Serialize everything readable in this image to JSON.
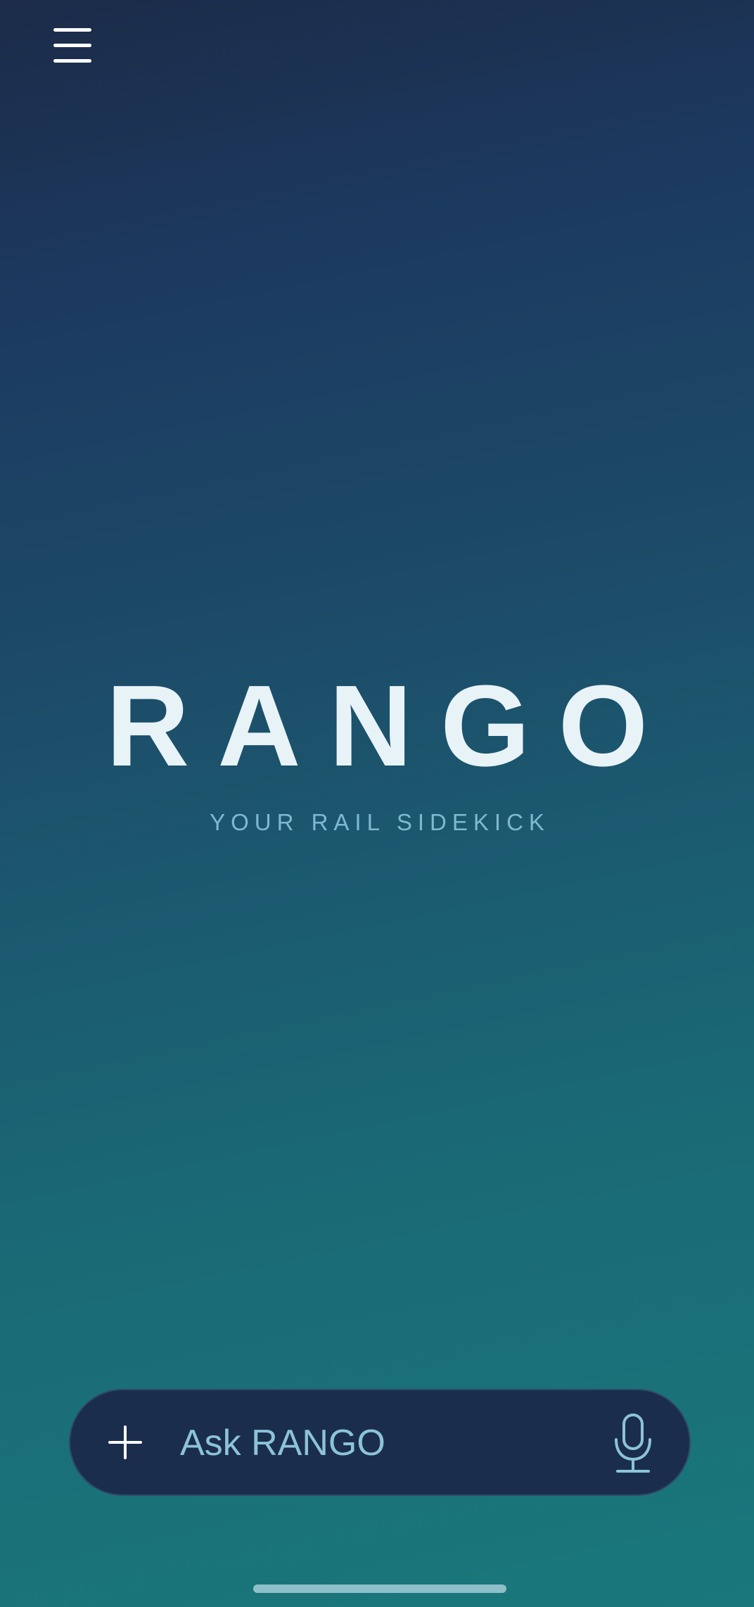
{
  "app": {
    "title": "RANGO",
    "tagline": "YOUR RAIL SIDEKICK"
  },
  "header": {
    "menu_icon": "hamburger-menu-icon"
  },
  "composer": {
    "add_icon": "plus-icon",
    "placeholder": "Ask RANGO",
    "value": "",
    "mic_icon": "microphone-icon"
  },
  "colors": {
    "gradient_top": "#1b2b48",
    "gradient_bottom": "#19787a",
    "title": "#e8f3f8",
    "tagline": "#7fb9cf",
    "composer_bg": "#1b2d4d",
    "composer_text": "#8cc3d8"
  }
}
